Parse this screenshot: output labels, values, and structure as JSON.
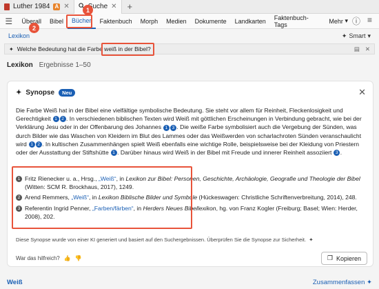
{
  "tabs": [
    {
      "label": "Luther 1984",
      "badge": "A"
    },
    {
      "label": "Suche"
    }
  ],
  "nav": {
    "items": [
      "Überall",
      "Bibel",
      "Bücher",
      "Faktenbuch",
      "Morph",
      "Medien",
      "Dokumente",
      "Landkarten",
      "Faktenbuch-Tags",
      "Mehr"
    ],
    "active": "Bücher"
  },
  "subbar": {
    "lexicon_link": "Lexikon",
    "smart_label": "Smart"
  },
  "query": {
    "text": "Welche Bedeutung hat die Farbe weiß in der Bibel?"
  },
  "results": {
    "label": "Lexikon",
    "count": "Ergebnisse 1–50"
  },
  "card": {
    "title": "Synopse",
    "new_badge": "Neu",
    "summary_parts": [
      "Die Farbe Weiß hat in der Bibel eine vielfältige symbolische Bedeutung. Sie steht vor allem für Reinheit, Fleckenlosigkeit und Gerechtigkeit",
      ". In verschiedenen biblischen Texten wird Weiß mit göttlichen Erscheinungen in Verbindung gebracht, wie bei der Verklärung Jesu oder in der Offenbarung des Johannes",
      ". Die weiße Farbe symbolisiert auch die Vergebung der Sünden, was durch Bilder wie das Waschen von Kleidern im Blut des Lammes oder das Weißwerden von scharlachroten Sünden veranschaulicht wird",
      ". In kultischen Zusammenhängen spielt Weiß ebenfalls eine wichtige Rolle, beispielsweise bei der Kleidung von Priestern oder der Ausstattung der Stiftshütte",
      ". Darüber hinaus wird Weiß in der Bibel mit Freude und innerer Reinheit assoziiert",
      "."
    ],
    "refs": [
      {
        "n": "1",
        "pre": "Fritz Rienecker u. a., Hrsg., ",
        "link": "„Weiß“",
        "mid": ", in ",
        "italic": "Lexikon zur Bibel: Personen, Geschichte, Archäologie, Geografie und Theologie der Bibel",
        "post": " (Witten: SCM R. Brockhaus, 2017), 1249."
      },
      {
        "n": "2",
        "pre": "Arend Remmers, ",
        "link": "„Weiß“",
        "mid": ", in ",
        "italic": "Lexikon Biblische Bilder und Symbole",
        "post": " (Hückeswagen: Christliche Schriftenverbreitung, 2014), 248."
      },
      {
        "n": "3",
        "pre": "Referentin Ingrid Penner, ",
        "link": "„Farben/färben“",
        "mid": ", in ",
        "italic": "Herders Neues Bibellexikon",
        "post": ", hg. von Franz Kogler (Freiburg; Basel; Wien: Herder, 2008), 202."
      }
    ],
    "disclaimer": "Diese Synopse wurde von einer KI generiert und basiert auf den Suchergebnissen. Überprüfen Sie die Synopse zur Sicherheit.",
    "feedback_label": "War das hilfreich?",
    "copy_label": "Kopieren"
  },
  "bottom": {
    "word": "Weiß",
    "summarize": "Zusammenfassen"
  },
  "callouts": [
    "1",
    "2"
  ],
  "colors": {
    "accent": "#1a5fb4",
    "annotation": "#e8533a"
  }
}
